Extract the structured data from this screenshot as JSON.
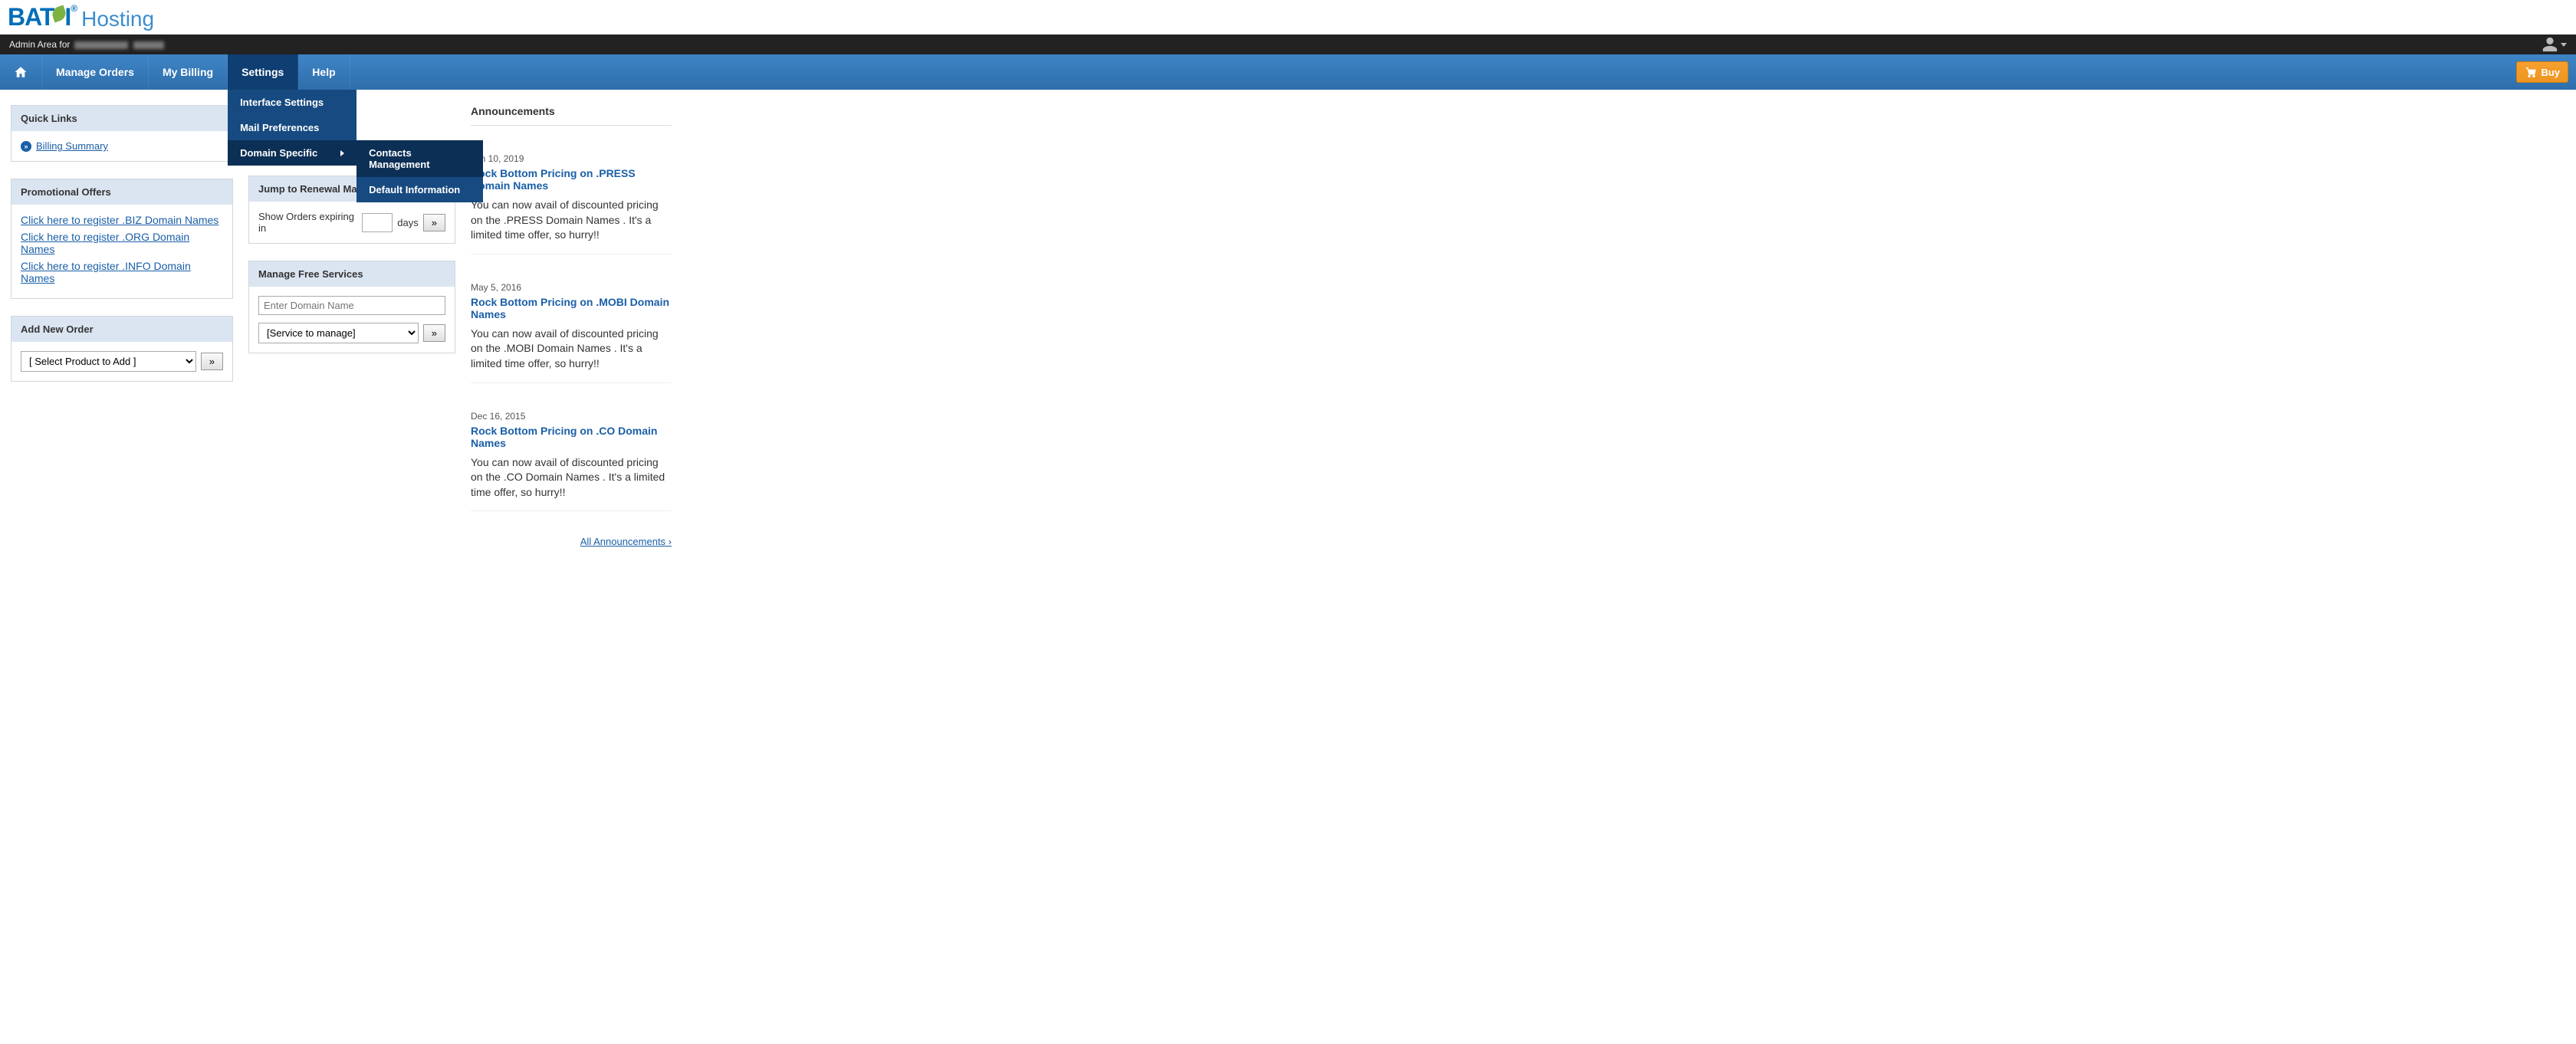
{
  "brand": {
    "part1": "BAT",
    "part2": "I",
    "reg": "®",
    "suffix": "Hosting"
  },
  "admin_bar": {
    "prefix": "Admin Area for"
  },
  "nav": {
    "manage_orders": "Manage Orders",
    "my_billing": "My Billing",
    "settings": "Settings",
    "help": "Help",
    "buy": "Buy"
  },
  "settings_menu": {
    "interface": "Interface Settings",
    "mail": "Mail Preferences",
    "domain_specific": "Domain Specific",
    "submenu": {
      "contacts": "Contacts Management",
      "default_info": "Default Information"
    }
  },
  "quick_links": {
    "title": "Quick Links",
    "billing_summary": "Billing Summary"
  },
  "promo": {
    "title": "Promotional Offers",
    "links": [
      "Click here to register .BIZ Domain Names",
      "Click here to register .ORG Domain Names",
      "Click here to register .INFO Domain Names"
    ]
  },
  "add_order": {
    "title": "Add New Order",
    "select_placeholder": "[ Select Product to Add ]",
    "go": "»"
  },
  "renewal": {
    "title": "Jump to Renewal Management",
    "prefix": "Show Orders expiring in",
    "suffix": "days",
    "go": "»"
  },
  "free_services": {
    "title": "Manage Free Services",
    "domain_placeholder": "Enter Domain Name",
    "service_placeholder": "[Service to manage]",
    "go": "»"
  },
  "announcements": {
    "title": "Announcements",
    "items": [
      {
        "date": "Jun 10, 2019",
        "title": "Rock Bottom Pricing on .PRESS Domain Names",
        "body": "You can now avail of discounted pricing on the .PRESS Domain Names . It's a limited time offer, so hurry!!"
      },
      {
        "date": "May 5, 2016",
        "title": "Rock Bottom Pricing on .MOBI Domain Names",
        "body": "You can now avail of discounted pricing on the .MOBI Domain Names . It's a limited time offer, so hurry!!"
      },
      {
        "date": "Dec 16, 2015",
        "title": "Rock Bottom Pricing on .CO Domain Names",
        "body": "You can now avail of discounted pricing on the .CO Domain Names . It's a limited time offer, so hurry!!"
      }
    ],
    "all_link": "All Announcements ›"
  }
}
